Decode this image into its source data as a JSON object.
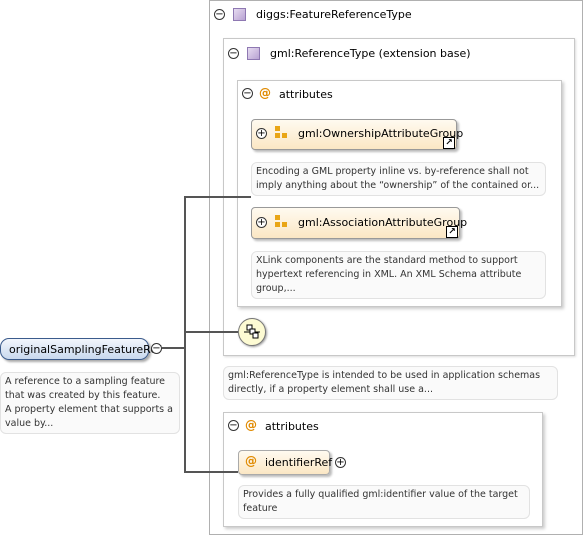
{
  "complex_type": {
    "name": "diggs:FeatureReferenceType",
    "base": {
      "name": "gml:ReferenceType (extension base)",
      "attributes": {
        "label": "attributes",
        "groups": [
          {
            "name": "gml:OwnershipAttributeGroup",
            "doc_lines": [
              "Encoding a GML property inline vs. by-reference shall not",
              "imply anything about the “ownership” of the contained or..."
            ]
          },
          {
            "name": "gml:AssociationAttributeGroup",
            "doc_lines": [
              "XLink components are the standard method to support",
              "hypertext referencing in XML. An XML Schema attribute",
              "group,..."
            ]
          }
        ]
      },
      "doc_lines": [
        "gml:ReferenceType is intended to be used in application schemas",
        "directly, if a property element shall use a..."
      ]
    },
    "attributes": {
      "label": "attributes",
      "attribute": {
        "name": "identifierRef",
        "doc_lines": [
          "Provides a fully qualified gml:identifier value of the target",
          "feature"
        ]
      }
    }
  },
  "element": {
    "name": "originalSamplingFeatureRef",
    "doc_lines": [
      "A reference to a sampling feature",
      "that was created by this feature.",
      "A property element that supports a",
      "value by..."
    ]
  },
  "icons": {
    "collapse": "−",
    "expand": "+",
    "attribute": "@",
    "link": "↗"
  },
  "colors": {
    "element_fill": "#dfe9f6",
    "element_border": "#3b5b8c",
    "group_fill": "#fbe7c4",
    "group_icon": "#e9a515",
    "attribute_icon": "#e08a00",
    "sequence_fill": "#fdfbd3"
  }
}
